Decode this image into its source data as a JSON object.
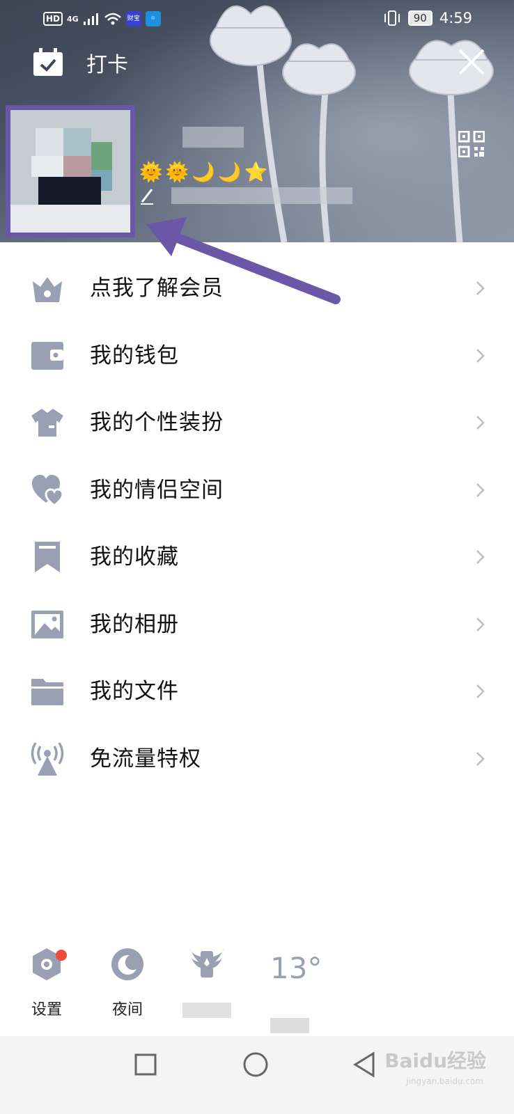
{
  "status_bar": {
    "hd": "HD",
    "network": "4G",
    "app_badge_1": "财宝",
    "battery": "90",
    "time": "4:59"
  },
  "header": {
    "checkin_label": "打卡",
    "badges": [
      "🌞",
      "🌞",
      "🌙",
      "🌙",
      "⭐"
    ]
  },
  "menu": {
    "items": [
      {
        "label": "点我了解会员",
        "icon": "crown-icon"
      },
      {
        "label": "我的钱包",
        "icon": "wallet-icon"
      },
      {
        "label": "我的个性装扮",
        "icon": "tshirt-icon"
      },
      {
        "label": "我的情侣空间",
        "icon": "hearts-icon"
      },
      {
        "label": "我的收藏",
        "icon": "bookmark-icon"
      },
      {
        "label": "我的相册",
        "icon": "image-icon"
      },
      {
        "label": "我的文件",
        "icon": "folder-icon"
      },
      {
        "label": "免流量特权",
        "icon": "antenna-icon"
      }
    ]
  },
  "bottom": {
    "settings_label": "设置",
    "night_label": "夜间",
    "weather_temp": "13°"
  },
  "colors": {
    "icon_gray": "#9aa0b4",
    "annotation": "#6a57a8",
    "notification_dot": "#ef4a3a"
  },
  "watermark": {
    "text": "Baidu经验",
    "sub": "jingyan.baidu.com"
  }
}
